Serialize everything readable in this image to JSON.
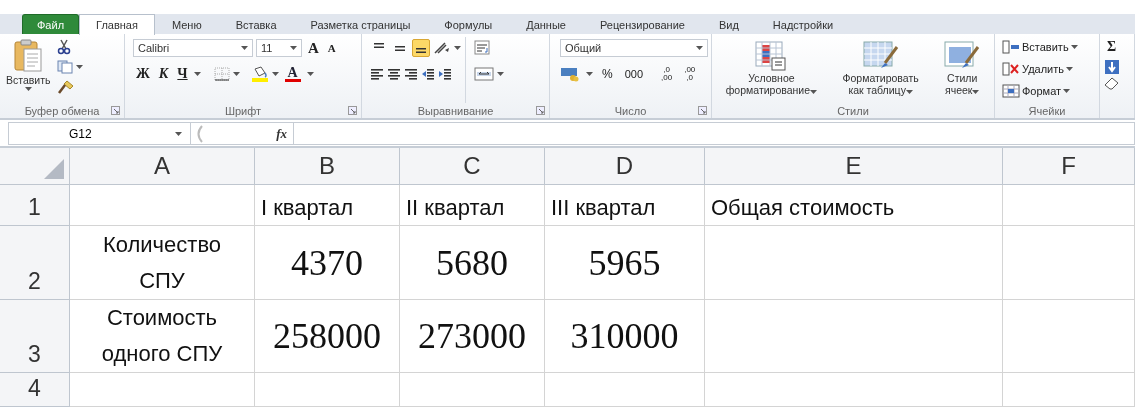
{
  "tabs": [
    {
      "label": "Файл",
      "kind": "file",
      "selected": false
    },
    {
      "label": "Главная",
      "kind": "tab",
      "selected": true
    },
    {
      "label": "Меню",
      "kind": "tab",
      "selected": false
    },
    {
      "label": "Вставка",
      "kind": "tab",
      "selected": false
    },
    {
      "label": "Разметка страницы",
      "kind": "tab",
      "selected": false
    },
    {
      "label": "Формулы",
      "kind": "tab",
      "selected": false
    },
    {
      "label": "Данные",
      "kind": "tab",
      "selected": false
    },
    {
      "label": "Рецензирование",
      "kind": "tab",
      "selected": false
    },
    {
      "label": "Вид",
      "kind": "tab",
      "selected": false
    },
    {
      "label": "Надстройки",
      "kind": "tab",
      "selected": false
    }
  ],
  "ribbon": {
    "groups": [
      {
        "kind": "clipboard",
        "label": "Буфер обмена",
        "launcher": true,
        "paste_label": "Вставить"
      },
      {
        "kind": "font",
        "label": "Шрифт",
        "launcher": true,
        "font_name": "Calibri",
        "font_size": "11",
        "grow": "A",
        "shrink": "A",
        "bold": "Ж",
        "italic": "К",
        "underline": "Ч",
        "font_color": "A"
      },
      {
        "kind": "alignment",
        "label": "Выравнивание",
        "launcher": true,
        "vertical_align": [
          {
            "selected": false
          },
          {
            "selected": false
          },
          {
            "selected": true
          }
        ]
      },
      {
        "kind": "number",
        "label": "Число",
        "launcher": true,
        "format": "Общий",
        "percent": "%",
        "thousands": "000",
        "increase_decimal": [
          ",0",
          ",00"
        ],
        "decrease_decimal": [
          ",00",
          ",0"
        ]
      },
      {
        "kind": "styles",
        "label": "Стили",
        "buttons": [
          {
            "lines": [
              "Условное",
              "форматирование"
            ]
          },
          {
            "lines": [
              "Форматировать",
              "как таблицу"
            ]
          },
          {
            "lines": [
              "Стили",
              "ячеек"
            ]
          }
        ]
      },
      {
        "kind": "cells",
        "label": "Ячейки",
        "buttons": [
          {
            "label": "Вставить"
          },
          {
            "label": "Удалить"
          },
          {
            "label": "Формат"
          }
        ]
      },
      {
        "kind": "editing",
        "sum": "Σ"
      }
    ]
  },
  "formula_bar": {
    "name_box": "G12",
    "fx": "fx"
  },
  "sheet": {
    "columns": [
      "A",
      "B",
      "C",
      "D",
      "E",
      "F"
    ],
    "rows": [
      {
        "header": "1",
        "cells": [
          {
            "kind": "empty"
          },
          {
            "kind": "text",
            "text": "I квартал"
          },
          {
            "kind": "text",
            "text": "II квартал"
          },
          {
            "kind": "text",
            "text": "III квартал"
          },
          {
            "kind": "text",
            "text": "Общая стоимость"
          },
          {
            "kind": "empty"
          }
        ]
      },
      {
        "header": "2",
        "cells": [
          {
            "kind": "label",
            "text": "Количество СПУ"
          },
          {
            "kind": "number",
            "text": "4370"
          },
          {
            "kind": "number",
            "text": "5680"
          },
          {
            "kind": "number",
            "text": "5965"
          },
          {
            "kind": "empty"
          },
          {
            "kind": "empty"
          }
        ]
      },
      {
        "header": "3",
        "cells": [
          {
            "kind": "label",
            "text": "Стоимость одного СПУ"
          },
          {
            "kind": "number",
            "text": "258000"
          },
          {
            "kind": "number",
            "text": "273000"
          },
          {
            "kind": "number",
            "text": "310000"
          },
          {
            "kind": "empty"
          },
          {
            "kind": "empty"
          }
        ]
      },
      {
        "header": "4",
        "cells": []
      }
    ]
  }
}
